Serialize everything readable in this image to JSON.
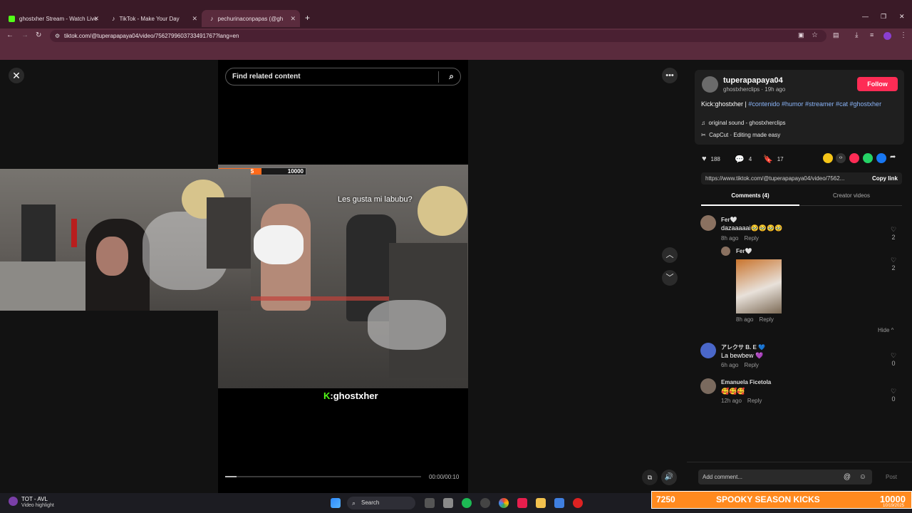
{
  "browser": {
    "tabs": [
      {
        "title": "ghostxher Stream - Watch Live",
        "color": "#53fc18"
      },
      {
        "title": "TikTok - Make Your Day",
        "color": "#ffffff"
      },
      {
        "title": "pechurinaconpapas (@gh",
        "color": "#ffffff"
      }
    ],
    "url": "tiktok.com/@tuperapapaya04/video/7562799603733491767?lang=en"
  },
  "video": {
    "search_placeholder": "Find related content",
    "score": "10000",
    "score_prefix": "S",
    "caption": "Les gusta mi labubu?",
    "kick_prefix": "K",
    "kick_handle": ":ghostxher",
    "time": "00:00/00:10"
  },
  "post": {
    "username": "tuperapapaya04",
    "sub": "ghostxherclips · 19h ago",
    "follow": "Follow",
    "desc_prefix": "Kick:ghostxher | ",
    "tags": [
      "#contenido",
      "#humor",
      "#streamer",
      "#cat",
      "#ghostxher"
    ],
    "sound": "original sound - ghostxherclips",
    "capcut": "CapCut · Editing made easy",
    "likes": "188",
    "comments_count": "4",
    "saves": "17",
    "link": "https://www.tiktok.com/@tuperapapaya04/video/7562...",
    "copy_link": "Copy link",
    "tab_comments": "Comments (4)",
    "tab_creator": "Creator videos"
  },
  "comments": [
    {
      "name": "Fer🤍",
      "text": "dazaaaaai🥹🥹🥹🥹",
      "time": "8h ago",
      "reply": "Reply",
      "likes": "2"
    },
    {
      "name": "Fer🤍",
      "text": "",
      "time": "8h ago",
      "reply": "Reply",
      "likes": "2"
    },
    {
      "name": "アレクサ B. E 💙",
      "text": "La bewbew 💜",
      "time": "6h ago",
      "reply": "Reply",
      "likes": "0"
    },
    {
      "name": "Emanuela Ficetola",
      "text": "🥰🥰🥰",
      "time": "12h ago",
      "reply": "Reply",
      "likes": "0"
    }
  ],
  "hide": "Hide ^",
  "add_comment": "Add comment...",
  "post_btn": "Post",
  "taskbar": {
    "media_title": "TOT - AVL",
    "media_sub": "Video highlight",
    "search": "Search",
    "overlay_left": "7250",
    "overlay_title": "SPOOKY SEASON KICKS",
    "overlay_right": "10000",
    "date": "10/19/2025"
  }
}
